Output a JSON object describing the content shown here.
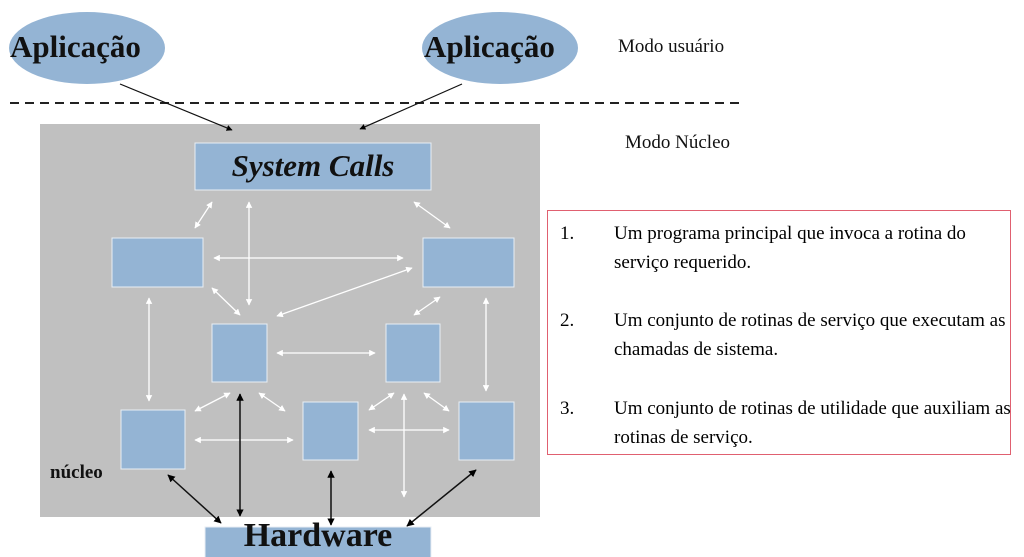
{
  "applications": [
    "Aplicação",
    "Aplicação"
  ],
  "modes": {
    "user": "Modo usuário",
    "kernel": "Modo Núcleo"
  },
  "system_calls": "System Calls",
  "kernel_label": "núcleo",
  "hardware": "Hardware",
  "list": [
    {
      "num": "1.",
      "text": "Um programa principal que invoca a rotina do serviço requerido."
    },
    {
      "num": "2.",
      "text": "Um conjunto de rotinas de serviço que executam as chamadas de sistema."
    },
    {
      "num": "3.",
      "text": "Um conjunto de rotinas de utilidade que auxiliam as rotinas de serviço."
    }
  ],
  "colors": {
    "box": "#94b4d4",
    "kernel": "#c0c0c0",
    "list_border": "#e06070"
  }
}
